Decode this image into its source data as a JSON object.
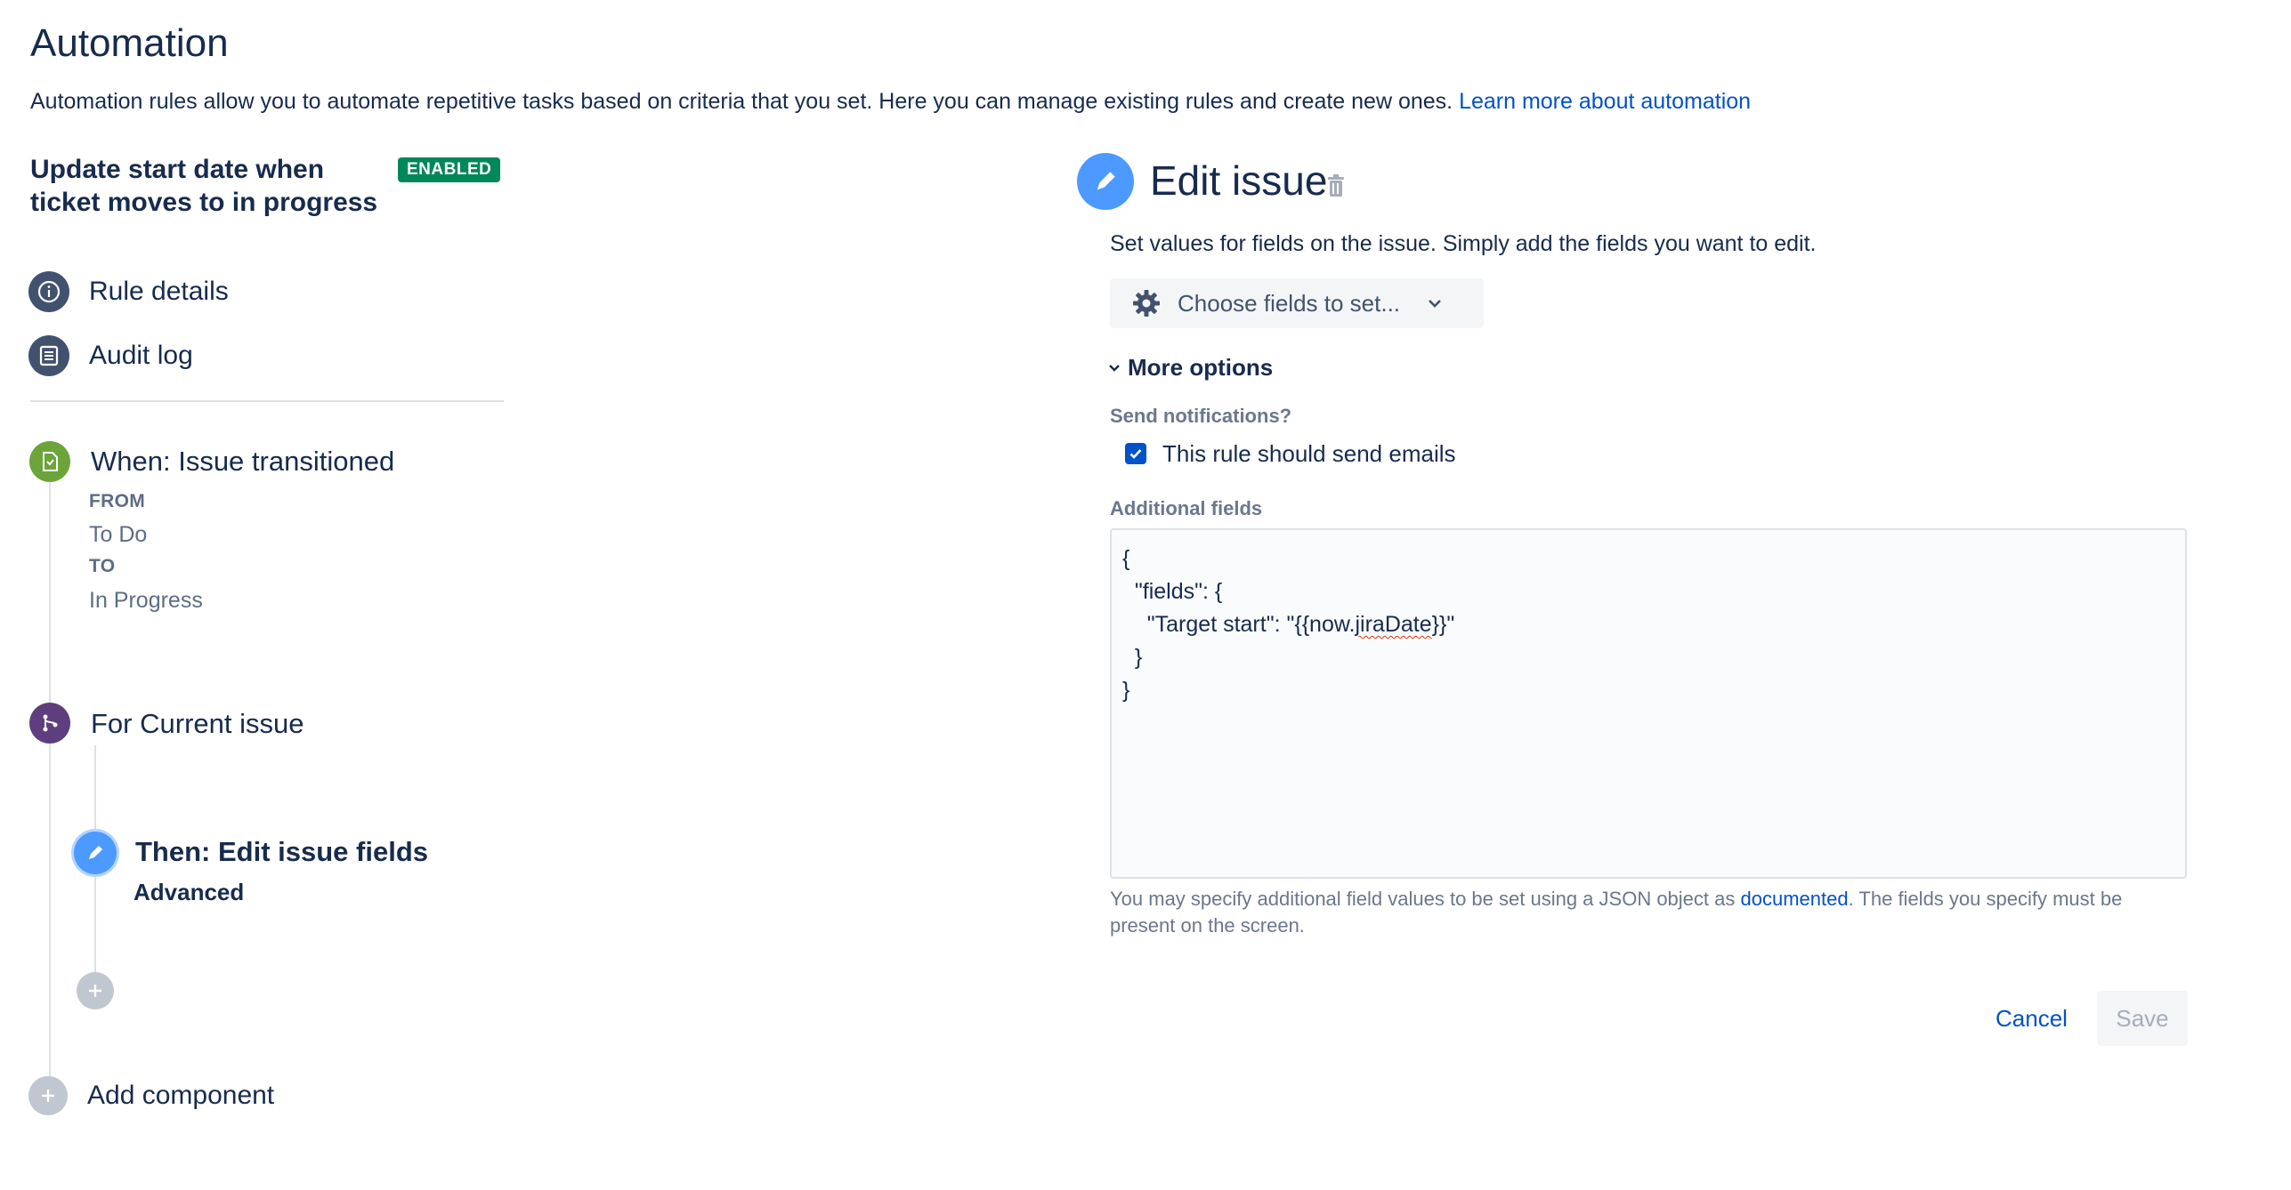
{
  "header": {
    "title": "Automation",
    "description": "Automation rules allow you to automate repetitive tasks based on criteria that you set. Here you can manage existing rules and create new ones.",
    "learn_more": "Learn more about automation"
  },
  "rule": {
    "name": "Update start date when ticket moves to in progress",
    "status_badge": "ENABLED"
  },
  "nav": {
    "rule_details": "Rule details",
    "audit_log": "Audit log"
  },
  "trigger": {
    "title": "When: Issue transitioned",
    "from_label": "FROM",
    "from_value": "To Do",
    "to_label": "TO",
    "to_value": "In Progress"
  },
  "branch": {
    "title": "For Current issue"
  },
  "action": {
    "title": "Then: Edit issue fields",
    "subtitle": "Advanced"
  },
  "add_component": "Add component",
  "panel": {
    "title": "Edit issue",
    "description": "Set values for fields on the issue. Simply add the fields you want to edit.",
    "choose_fields": "Choose fields to set...",
    "more_options": "More options",
    "send_notifications_label": "Send notifications?",
    "checkbox_label": "This rule should send emails",
    "additional_fields_label": "Additional fields",
    "json": {
      "line1": "{",
      "line2": "  \"fields\": {",
      "line3_pre": "    \"Target start\": \"{{now.",
      "line3_word": "jiraDate",
      "line3_post": "}}\"",
      "line4": "  }",
      "line5": "}"
    },
    "helper_pre": "You may specify additional field values to be set using a JSON object as",
    "helper_link": "documented",
    "helper_post": ". The fields you specify must be present on the screen.",
    "cancel": "Cancel",
    "save": "Save"
  },
  "colors": {
    "accent": "#0052cc",
    "enabled": "#00875a",
    "nav_circle": "#42526e",
    "trigger": "#6ba539",
    "branch": "#5e3e7e",
    "action": "#4c9aff",
    "add": "#c1c7d0"
  },
  "icons": {
    "rule_details": "info-icon",
    "audit_log": "list-icon",
    "trigger": "transition-icon",
    "branch": "branch-icon",
    "action": "pencil-icon",
    "add": "plus-icon",
    "delete": "trash-icon",
    "settings": "gear-icon",
    "dropdown": "chevron-down-icon"
  }
}
